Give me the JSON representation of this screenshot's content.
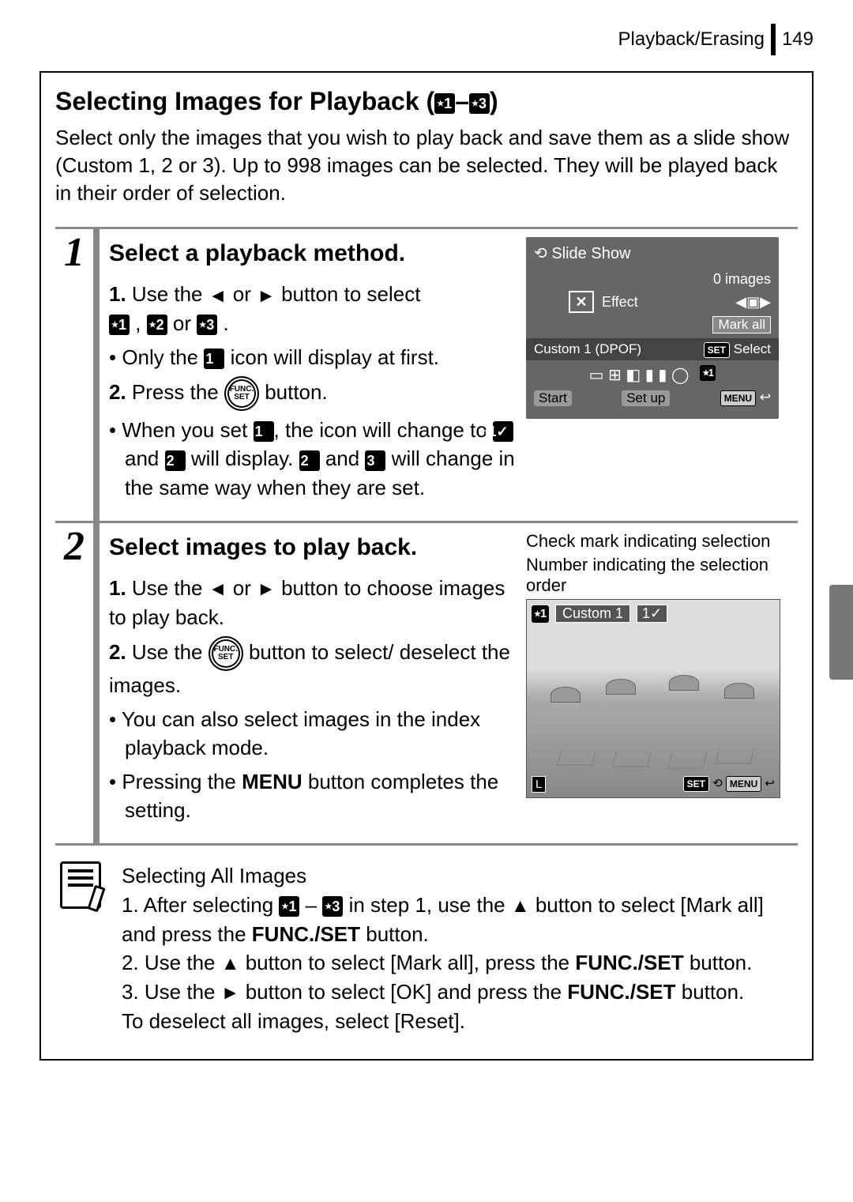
{
  "header": {
    "section": "Playback/Erasing",
    "page": "149"
  },
  "title": {
    "text": "Selecting Images for Playback (",
    "icon1": "1",
    "dash": "–",
    "icon3": "3",
    "close": ")"
  },
  "intro": "Select only the images that you wish to play back and save them as a slide show (Custom 1, 2 or 3). Up to 998 images can be selected. They will be played back in their order of selection.",
  "step1": {
    "num": "1",
    "heading": "Select a playback method.",
    "line1_a": "1.",
    "line1_b": " Use the ",
    "line1_c": " or ",
    "line1_d": " button to select ",
    "line1_e": " , ",
    "line1_f": " or ",
    "line1_g": " .",
    "bullet1_a": "• Only the ",
    "bullet1_b": " icon will display at first.",
    "line2_a": "2.",
    "line2_b": " Press the ",
    "line2_c": " button.",
    "bullet2_a": "• When you set ",
    "bullet2_b": ", the icon will change to ",
    "bullet2_c": " and ",
    "bullet2_d": " will display. ",
    "bullet2_e": " and ",
    "bullet2_f": " will change in the same way when they are set.",
    "star1": "1",
    "star2": "2",
    "star3": "3",
    "star1v": "1✓",
    "screen": {
      "title": "Slide Show",
      "images": "0 images",
      "effect": "Effect",
      "markall": "Mark all",
      "custom": "Custom 1 (DPOF)",
      "select": "Select",
      "set": "SET",
      "start": "Start",
      "setup": "Set up",
      "menu": "MENU"
    }
  },
  "step2": {
    "num": "2",
    "heading": "Select images to play back.",
    "line1_a": "1.",
    "line1_b": " Use the ",
    "line1_c": " or ",
    "line1_d": " button to choose images to play back.",
    "line2_a": "2.",
    "line2_b": " Use the ",
    "line2_c": " button to select/ deselect the images.",
    "bullet1": "• You can also select images in the index playback mode.",
    "bullet2_a": "• Pressing the ",
    "bullet2_b": "MENU",
    "bullet2_c": " button completes the setting.",
    "caption1": "Check mark indicating selection",
    "caption2": "Number indicating the selection order",
    "photo": {
      "star1": "1",
      "custom": "Custom 1",
      "order": "1✓",
      "res": "L",
      "set": "SET",
      "menu": "MENU"
    }
  },
  "note": {
    "title": "Selecting All Images",
    "l1_a": "1. After selecting ",
    "l1_b": " – ",
    "l1_c": " in step 1, use the ",
    "l1_d": " button to select [Mark all] and press the ",
    "l1_e": "FUNC./SET",
    "l1_f": " button.",
    "l2_a": "2. Use the ",
    "l2_b": " button to select [Mark all], press the ",
    "l2_c": "FUNC./SET",
    "l2_d": " button.",
    "l3_a": "3. Use the ",
    "l3_b": " button to select [OK] and press the ",
    "l3_c": "FUNC./SET",
    "l3_d": " button.",
    "l4": "To deselect all images, select [Reset].",
    "star1": "1",
    "star3": "3"
  },
  "func": {
    "t": "FUNC.",
    "b": "SET"
  }
}
